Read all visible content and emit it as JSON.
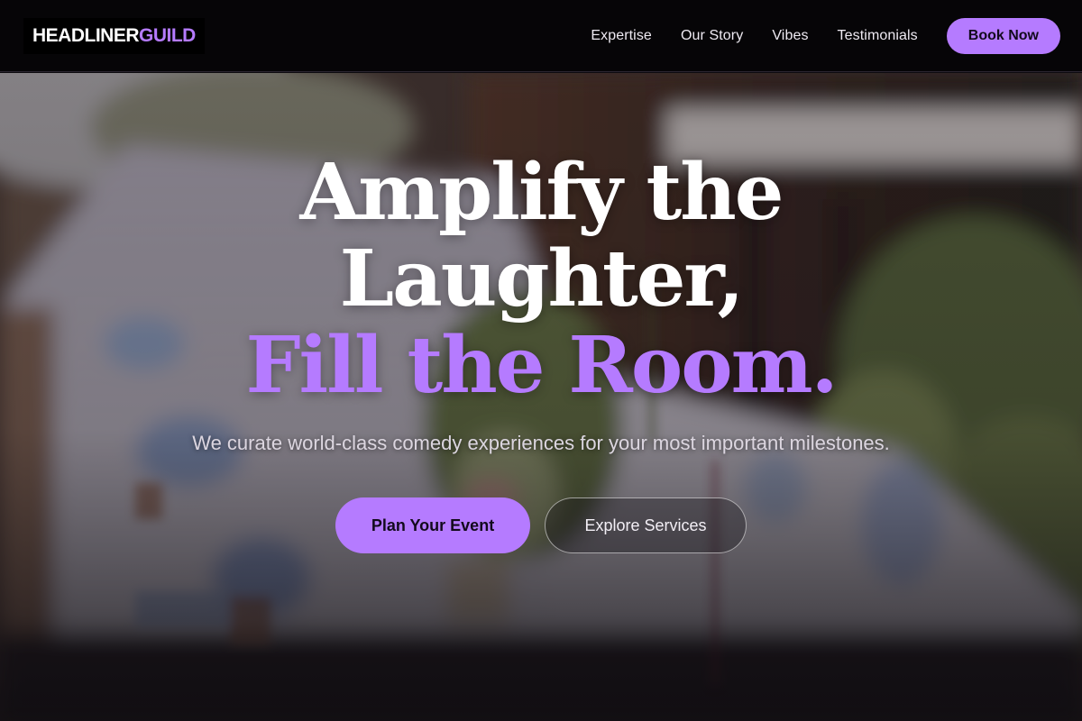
{
  "brand": {
    "part1": "HEADLINER",
    "part2": "GUILD"
  },
  "nav": {
    "items": [
      {
        "label": "Expertise"
      },
      {
        "label": "Our Story"
      },
      {
        "label": "Vibes"
      },
      {
        "label": "Testimonials"
      }
    ],
    "book_label": "Book Now"
  },
  "hero": {
    "line1": "Amplify the",
    "line2": "Laughter,",
    "line3": "Fill the Room.",
    "subtitle": "We curate world-class comedy experiences for your most important milestones.",
    "primary_cta": "Plan Your Event",
    "secondary_cta": "Explore Services"
  },
  "colors": {
    "accent": "#b57bff",
    "header_bg": "#060507",
    "text": "#ffffff"
  }
}
